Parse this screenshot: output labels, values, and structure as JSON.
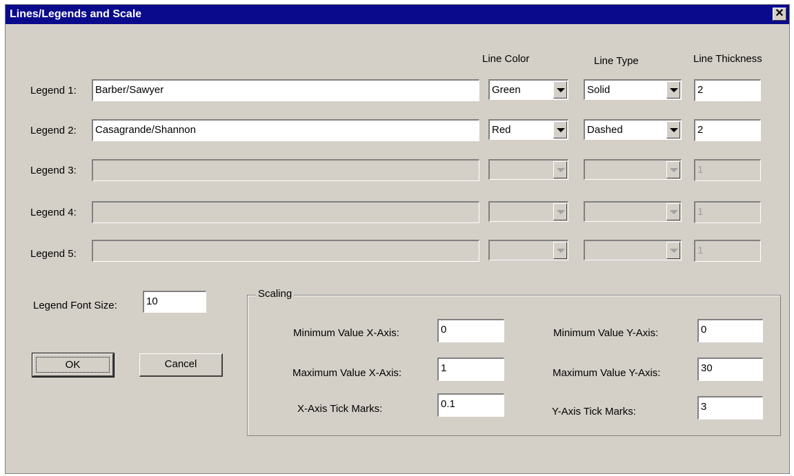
{
  "window": {
    "title": "Lines/Legends and Scale",
    "close_glyph": "✕"
  },
  "headers": {
    "line_color": "Line Color",
    "line_type": "Line Type",
    "line_thickness": "Line Thickness"
  },
  "legends": [
    {
      "label": "Legend 1:",
      "text": "Barber/Sawyer",
      "color": "Green",
      "type": "Solid",
      "thickness": "2",
      "enabled": true
    },
    {
      "label": "Legend 2:",
      "text": "Casagrande/Shannon",
      "color": "Red",
      "type": "Dashed",
      "thickness": "2",
      "enabled": true
    },
    {
      "label": "Legend 3:",
      "text": "",
      "color": "",
      "type": "",
      "thickness": "1",
      "enabled": false
    },
    {
      "label": "Legend 4:",
      "text": "",
      "color": "",
      "type": "",
      "thickness": "1",
      "enabled": false
    },
    {
      "label": "Legend 5:",
      "text": "",
      "color": "",
      "type": "",
      "thickness": "1",
      "enabled": false
    }
  ],
  "font_size": {
    "label": "Legend Font Size:",
    "value": "10"
  },
  "buttons": {
    "ok": "OK",
    "cancel": "Cancel"
  },
  "scaling": {
    "title": "Scaling",
    "min_x_label": "Minimum Value X-Axis:",
    "min_x": "0",
    "max_x_label": "Maximum Value X-Axis:",
    "max_x": "1",
    "x_ticks_label": "X-Axis Tick Marks:",
    "x_ticks": "0.1",
    "min_y_label": "Minimum Value Y-Axis:",
    "min_y": "0",
    "max_y_label": "Maximum Value Y-Axis:",
    "max_y": "30",
    "y_ticks_label": "Y-Axis Tick Marks:",
    "y_ticks": "3"
  }
}
